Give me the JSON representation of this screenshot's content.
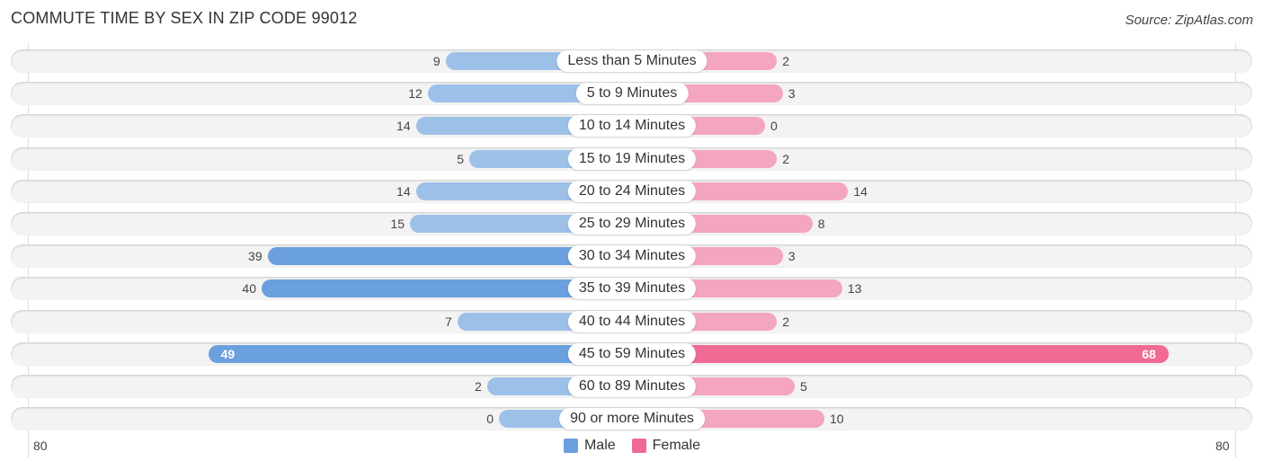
{
  "title": "COMMUTE TIME BY SEX IN ZIP CODE 99012",
  "source": "Source: ZipAtlas.com",
  "colors": {
    "male": "#9dc0e8",
    "male_strong": "#6aa0dd",
    "female": "#f4a6bf",
    "female_strong": "#f06a94"
  },
  "chart_data": {
    "type": "bar",
    "orientation": "horizontal-diverging",
    "title": "COMMUTE TIME BY SEX IN ZIP CODE 99012",
    "categories": [
      "Less than 5 Minutes",
      "5 to 9 Minutes",
      "10 to 14 Minutes",
      "15 to 19 Minutes",
      "20 to 24 Minutes",
      "25 to 29 Minutes",
      "30 to 34 Minutes",
      "35 to 39 Minutes",
      "40 to 44 Minutes",
      "45 to 59 Minutes",
      "60 to 89 Minutes",
      "90 or more Minutes"
    ],
    "series": [
      {
        "name": "Male",
        "values": [
          9,
          12,
          14,
          5,
          14,
          15,
          39,
          40,
          7,
          49,
          2,
          0
        ]
      },
      {
        "name": "Female",
        "values": [
          2,
          3,
          0,
          2,
          14,
          8,
          3,
          13,
          2,
          68,
          5,
          10
        ]
      }
    ],
    "axis": {
      "left_label": "80",
      "right_label": "80",
      "range": [
        0,
        80
      ]
    },
    "legend": {
      "position": "bottom-center",
      "entries": [
        "Male",
        "Female"
      ]
    },
    "grid": false
  }
}
